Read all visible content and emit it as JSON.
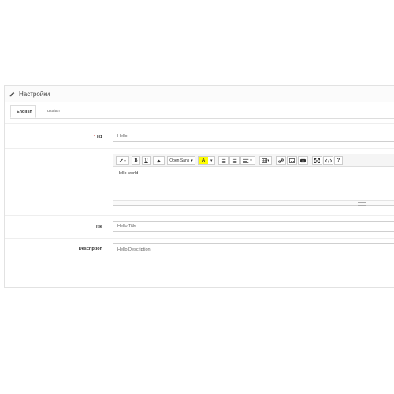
{
  "panel": {
    "title": "Настройки"
  },
  "tabs": [
    {
      "label": "English"
    },
    {
      "label": "russian"
    }
  ],
  "form": {
    "h1_required": "*",
    "h1_label": "H1",
    "h1_value": "Hello",
    "editor_content": "Hello world",
    "font_select": "Open Sans",
    "title_label": "Title",
    "title_value": "Hello Title",
    "description_label": "Description",
    "description_value": "Hello Description"
  },
  "toolbar": {
    "bold": "B",
    "underline": "U",
    "color_letter": "A",
    "help": "?",
    "highlight_color": "#ffff00"
  }
}
